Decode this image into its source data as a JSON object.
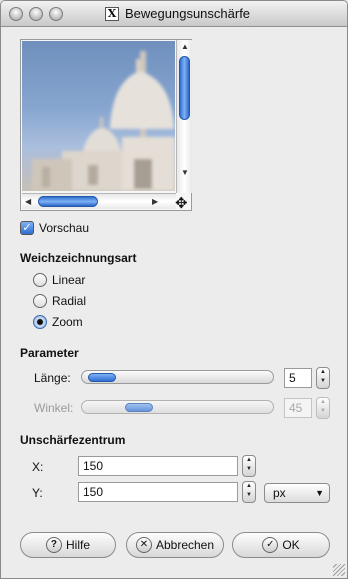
{
  "window": {
    "title": "Bewegungsunschärfe",
    "title_icon": "X"
  },
  "preview": {
    "nav_icon": "move-navigate-icon",
    "checkbox": {
      "label": "Vorschau",
      "checked": true
    }
  },
  "blur_type": {
    "heading": "Weichzeichnungsart",
    "options": [
      {
        "label": "Linear",
        "selected": false
      },
      {
        "label": "Radial",
        "selected": false
      },
      {
        "label": "Zoom",
        "selected": true
      }
    ]
  },
  "parameters": {
    "heading": "Parameter",
    "length": {
      "label": "Länge:",
      "value": "5",
      "enabled": true,
      "fraction": 0.02
    },
    "angle": {
      "label": "Winkel:",
      "value": "45",
      "enabled": false,
      "fraction": 0.25
    }
  },
  "center": {
    "heading": "Unschärfezentrum",
    "x": {
      "label": "X:",
      "value": "150"
    },
    "y": {
      "label": "Y:",
      "value": "150"
    },
    "unit": "px"
  },
  "buttons": {
    "help": "Hilfe",
    "cancel": "Abbrechen",
    "ok": "OK"
  }
}
